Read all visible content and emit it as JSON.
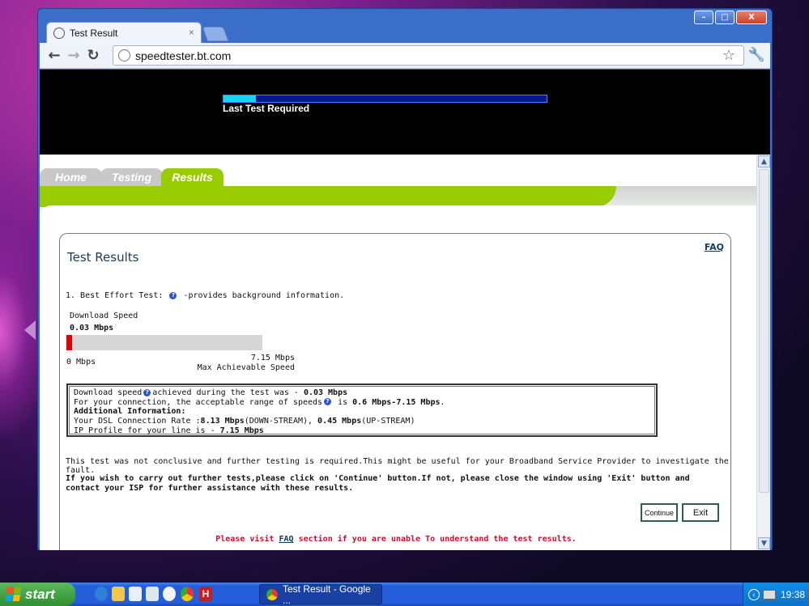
{
  "browser": {
    "tab_title": "Test Result",
    "tab_close": "×",
    "url": "speedtester.bt.com",
    "controls": {
      "minimize": "–",
      "maximize": "□",
      "close": "X"
    }
  },
  "banner": {
    "progress": 0.1,
    "label": "Last Test Required"
  },
  "nav": {
    "tabs": [
      {
        "label": "Home",
        "active": false
      },
      {
        "label": "Testing",
        "active": false
      },
      {
        "label": "Results",
        "active": true
      }
    ]
  },
  "results": {
    "faq_link": "FAQ",
    "title": "Test Results",
    "test_line_prefix": "1. Best Effort Test: ",
    "test_line_suffix": " -provides background information.",
    "download_label": "Download  Speed",
    "download_value": "0.03 Mbps",
    "download_fraction": 0.0042,
    "scale_min": "0 Mbps",
    "scale_max": "7.15 Mbps",
    "scale_max_label": "Max Achievable Speed",
    "info": {
      "line1_prefix": "Download speed",
      "line1_mid": "achieved during the test was - ",
      "line1_value": "0.03 Mbps",
      "line2_prefix": "For your connection, the acceptable range of speeds",
      "line2_mid": " is ",
      "line2_value": "0.6 Mbps-7.15 Mbps",
      "line2_end": ".",
      "additional_heading": "Additional Information:",
      "line4_prefix": "Your DSL Connection Rate :",
      "line4_down": "8.13 Mbps",
      "line4_down_label": "(DOWN-STREAM), ",
      "line4_up": "0.45 Mbps",
      "line4_up_label": "(UP-STREAM)",
      "line5_prefix": "IP Profile for your line is - ",
      "line5_value": "7.15 Mbps"
    },
    "inconclusive": "This test was not conclusive and further testing is required.This might be useful for your Broadband Service Provider to investigate the fault.",
    "instructions": "If you wish to carry out further tests,please click on 'Continue' button.If not, please close the window using 'Exit' button and contact your ISP for further assistance with these results.",
    "continue_label": "Continue",
    "exit_label": "Exit",
    "visit_prefix": "Please visit ",
    "visit_link": "FAQ",
    "visit_suffix": " section if you are unable To understand the test results."
  },
  "taskbar": {
    "start_label": "start",
    "task_item": "Test Result - Google ...",
    "clock": "19:38"
  },
  "colors": {
    "bt_green": "#99cc00",
    "progress_cyan": "#19d6ee",
    "speed_red": "#e00000",
    "warning_red": "#c8102e"
  }
}
